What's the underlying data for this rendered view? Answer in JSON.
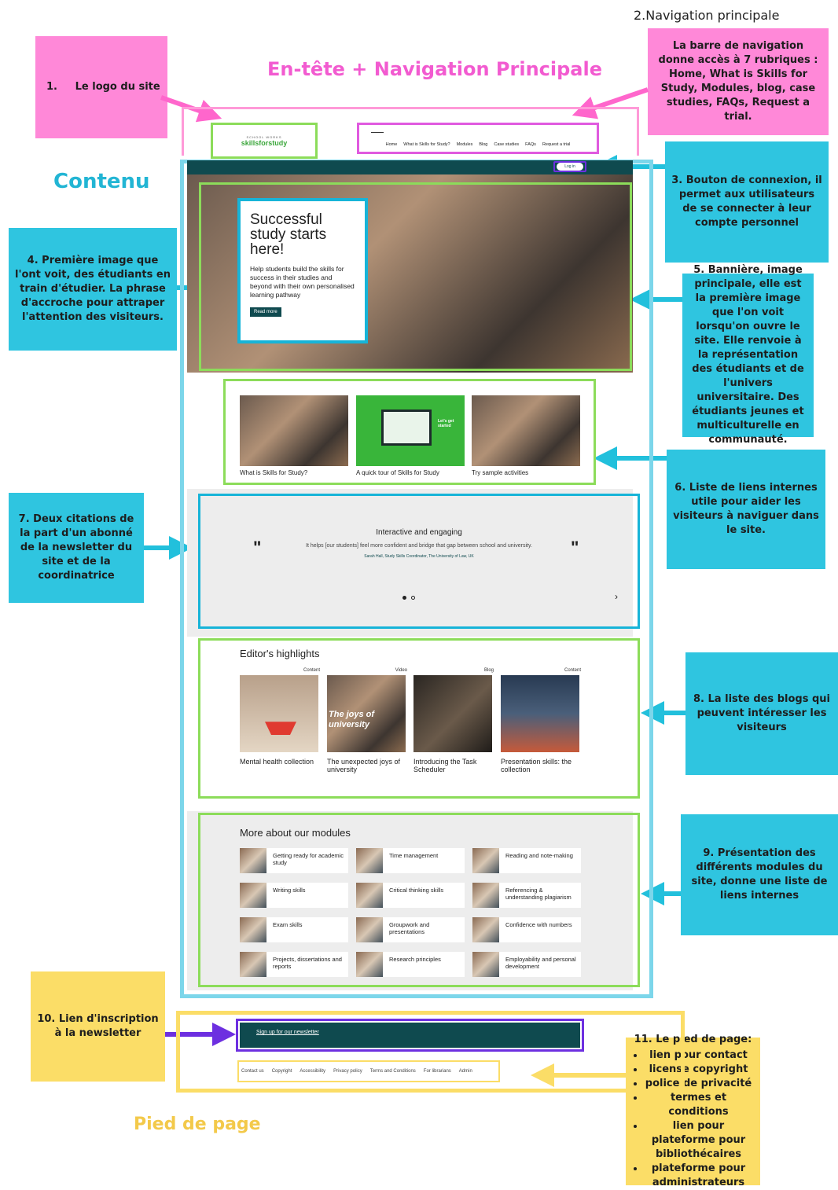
{
  "annotations": {
    "nav_title": "2.Navigation principale",
    "header_title": "En-tête + Navigation Principale",
    "content_title": "Contenu",
    "footer_title": "Pied de page",
    "note1": "1.     Le logo du site",
    "note2": "La barre de navigation donne accès à 7 rubriques : Home, What is Skills for Study, Modules, blog, case studies, FAQs, Request a trial.",
    "note3": "3. Bouton de connexion, il permet aux utilisateurs de se connecter à leur compte personnel",
    "note4": "4. Première image que l'ont voit, des étudiants en train d'étudier. La phrase d'accroche pour attraper l'attention des visiteurs.",
    "note5": "5. Bannière, image principale, elle est la première image que l'on voit lorsqu'on ouvre le site. Elle renvoie à la représentation des étudiants et de l'univers universitaire. Des étudiants jeunes et multiculturelle en communauté.",
    "note6": "6. Liste de liens internes utile pour aider les visiteurs à naviguer dans le site.",
    "note7": "7. Deux citations de la part d'un abonné de la newsletter du site et de la coordinatrice",
    "note8": "8. La liste des blogs qui peuvent intéresser les visiteurs",
    "note9": "9. Présentation des différents modules du site, donne une liste de liens internes",
    "note10": "10. Lien d'inscription à la newsletter",
    "note11_title": "11. Le pied de page:",
    "note11_items": [
      "lien pour contact",
      "license copyright",
      "police de privacité",
      "termes et conditions",
      "lien pour plateforme pour bibliothécaires",
      "plateforme pour administrateurs"
    ]
  },
  "site": {
    "logo_top": "SCHOOL WORKS",
    "logo_main": "skillsforstudy",
    "nav": [
      "Home",
      "What is Skills for Study?",
      "Modules",
      "Blog",
      "Case studies",
      "FAQs",
      "Request a trial"
    ],
    "login": "Log in",
    "hero_title": "Successful study starts here!",
    "hero_text": "Help students build the skills for success in their studies and beyond with their own personalised learning pathway",
    "hero_button": "Read more",
    "quick_links": [
      "What is Skills for Study?",
      "A quick tour of Skills for Study",
      "Try sample activities"
    ],
    "quick_badge": "Let's get started",
    "quote_heading": "Interactive and engaging",
    "quote_text": "It helps [our students] feel more confident and bridge that gap between school and university.",
    "quote_author": "Sarah Hall, Study Skills Coordinator, The University of Law, UK",
    "highlights_title": "Editor's highlights",
    "highlights": [
      {
        "type": "Content",
        "label": "Mental health collection"
      },
      {
        "type": "Video",
        "label": "The unexpected joys of university"
      },
      {
        "type": "Blog",
        "label": "Introducing the Task Scheduler"
      },
      {
        "type": "Content",
        "label": "Presentation skills: the collection"
      }
    ],
    "video_overlay": "The joys of university",
    "modules_title": "More about our modules",
    "modules": [
      "Getting ready for academic study",
      "Time management",
      "Reading and note-making",
      "Writing skills",
      "Critical thinking skills",
      "Referencing & understanding plagiarism",
      "Exam skills",
      "Groupwork and presentations",
      "Confidence with numbers",
      "Projects, dissertations and reports",
      "Research principles",
      "Employability and personal development"
    ],
    "newsletter": "Sign up for our newsletter",
    "footer_links": [
      "Contact us",
      "Copyright",
      "Accessibility",
      "Privacy policy",
      "Terms and Conditions",
      "For librarians",
      "Admin"
    ]
  },
  "colors": {
    "pink": "#ff88d8",
    "cyan": "#2fc5e0",
    "yellow": "#fbdd67",
    "green_frame": "#8cdc5a",
    "cyan_frame": "#7cd6ea",
    "purple": "#6d2fe0",
    "dark_teal": "#0f4a4f",
    "brand_green": "#3aa63a",
    "pink_title": "#f25bd0",
    "cyan_title": "#22b5d4",
    "yellow_title": "#f3c94a"
  }
}
